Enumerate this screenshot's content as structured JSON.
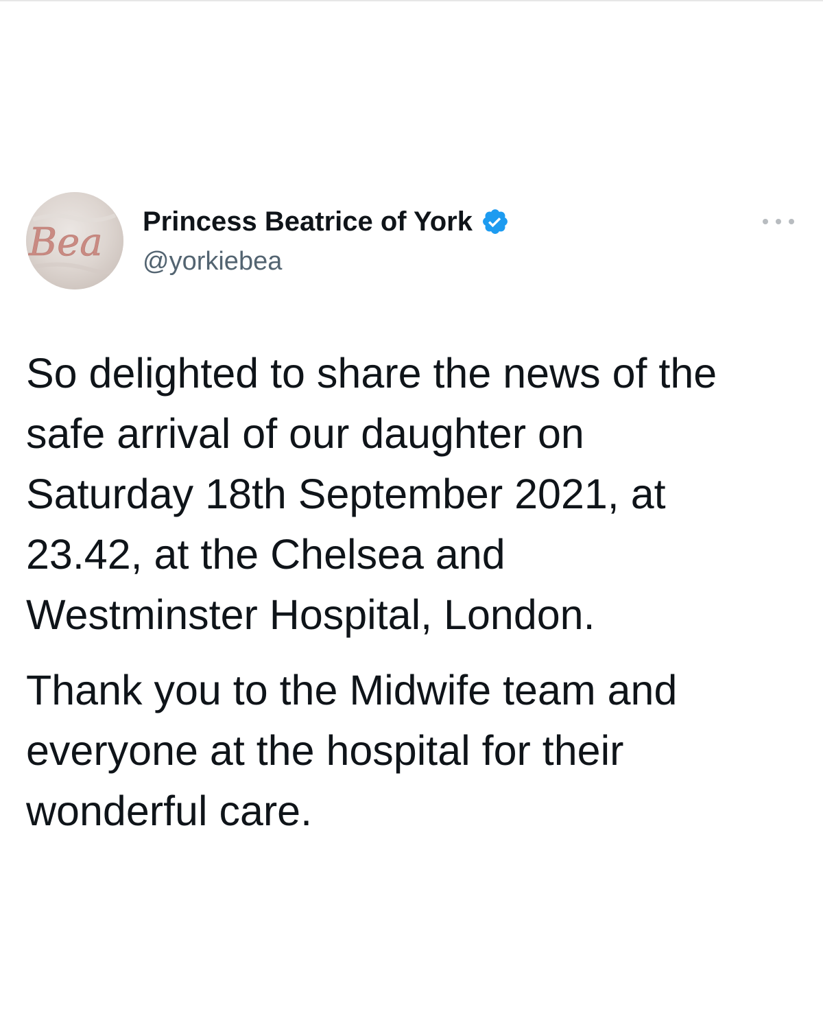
{
  "tweet": {
    "author": {
      "display_name": "Princess Beatrice of York",
      "handle": "@yorkiebea",
      "verified": true,
      "avatar_text": "Bea",
      "avatar_icon": "avatar-monogram"
    },
    "more_icon": "more-horizontal-icon",
    "paragraphs": [
      "So delighted to share the news of the\nsafe arrival of our daughter on\nSaturday 18th September 2021, at\n23.42, at the Chelsea and\nWestminster Hospital, London.",
      "Thank you to the Midwife team and\neveryone at the hospital for their\nwonderful care."
    ]
  },
  "colors": {
    "text_primary": "#0f1419",
    "text_secondary": "#536471",
    "verified_blue": "#1d9bf0",
    "avatar_script": "#c98a82"
  }
}
